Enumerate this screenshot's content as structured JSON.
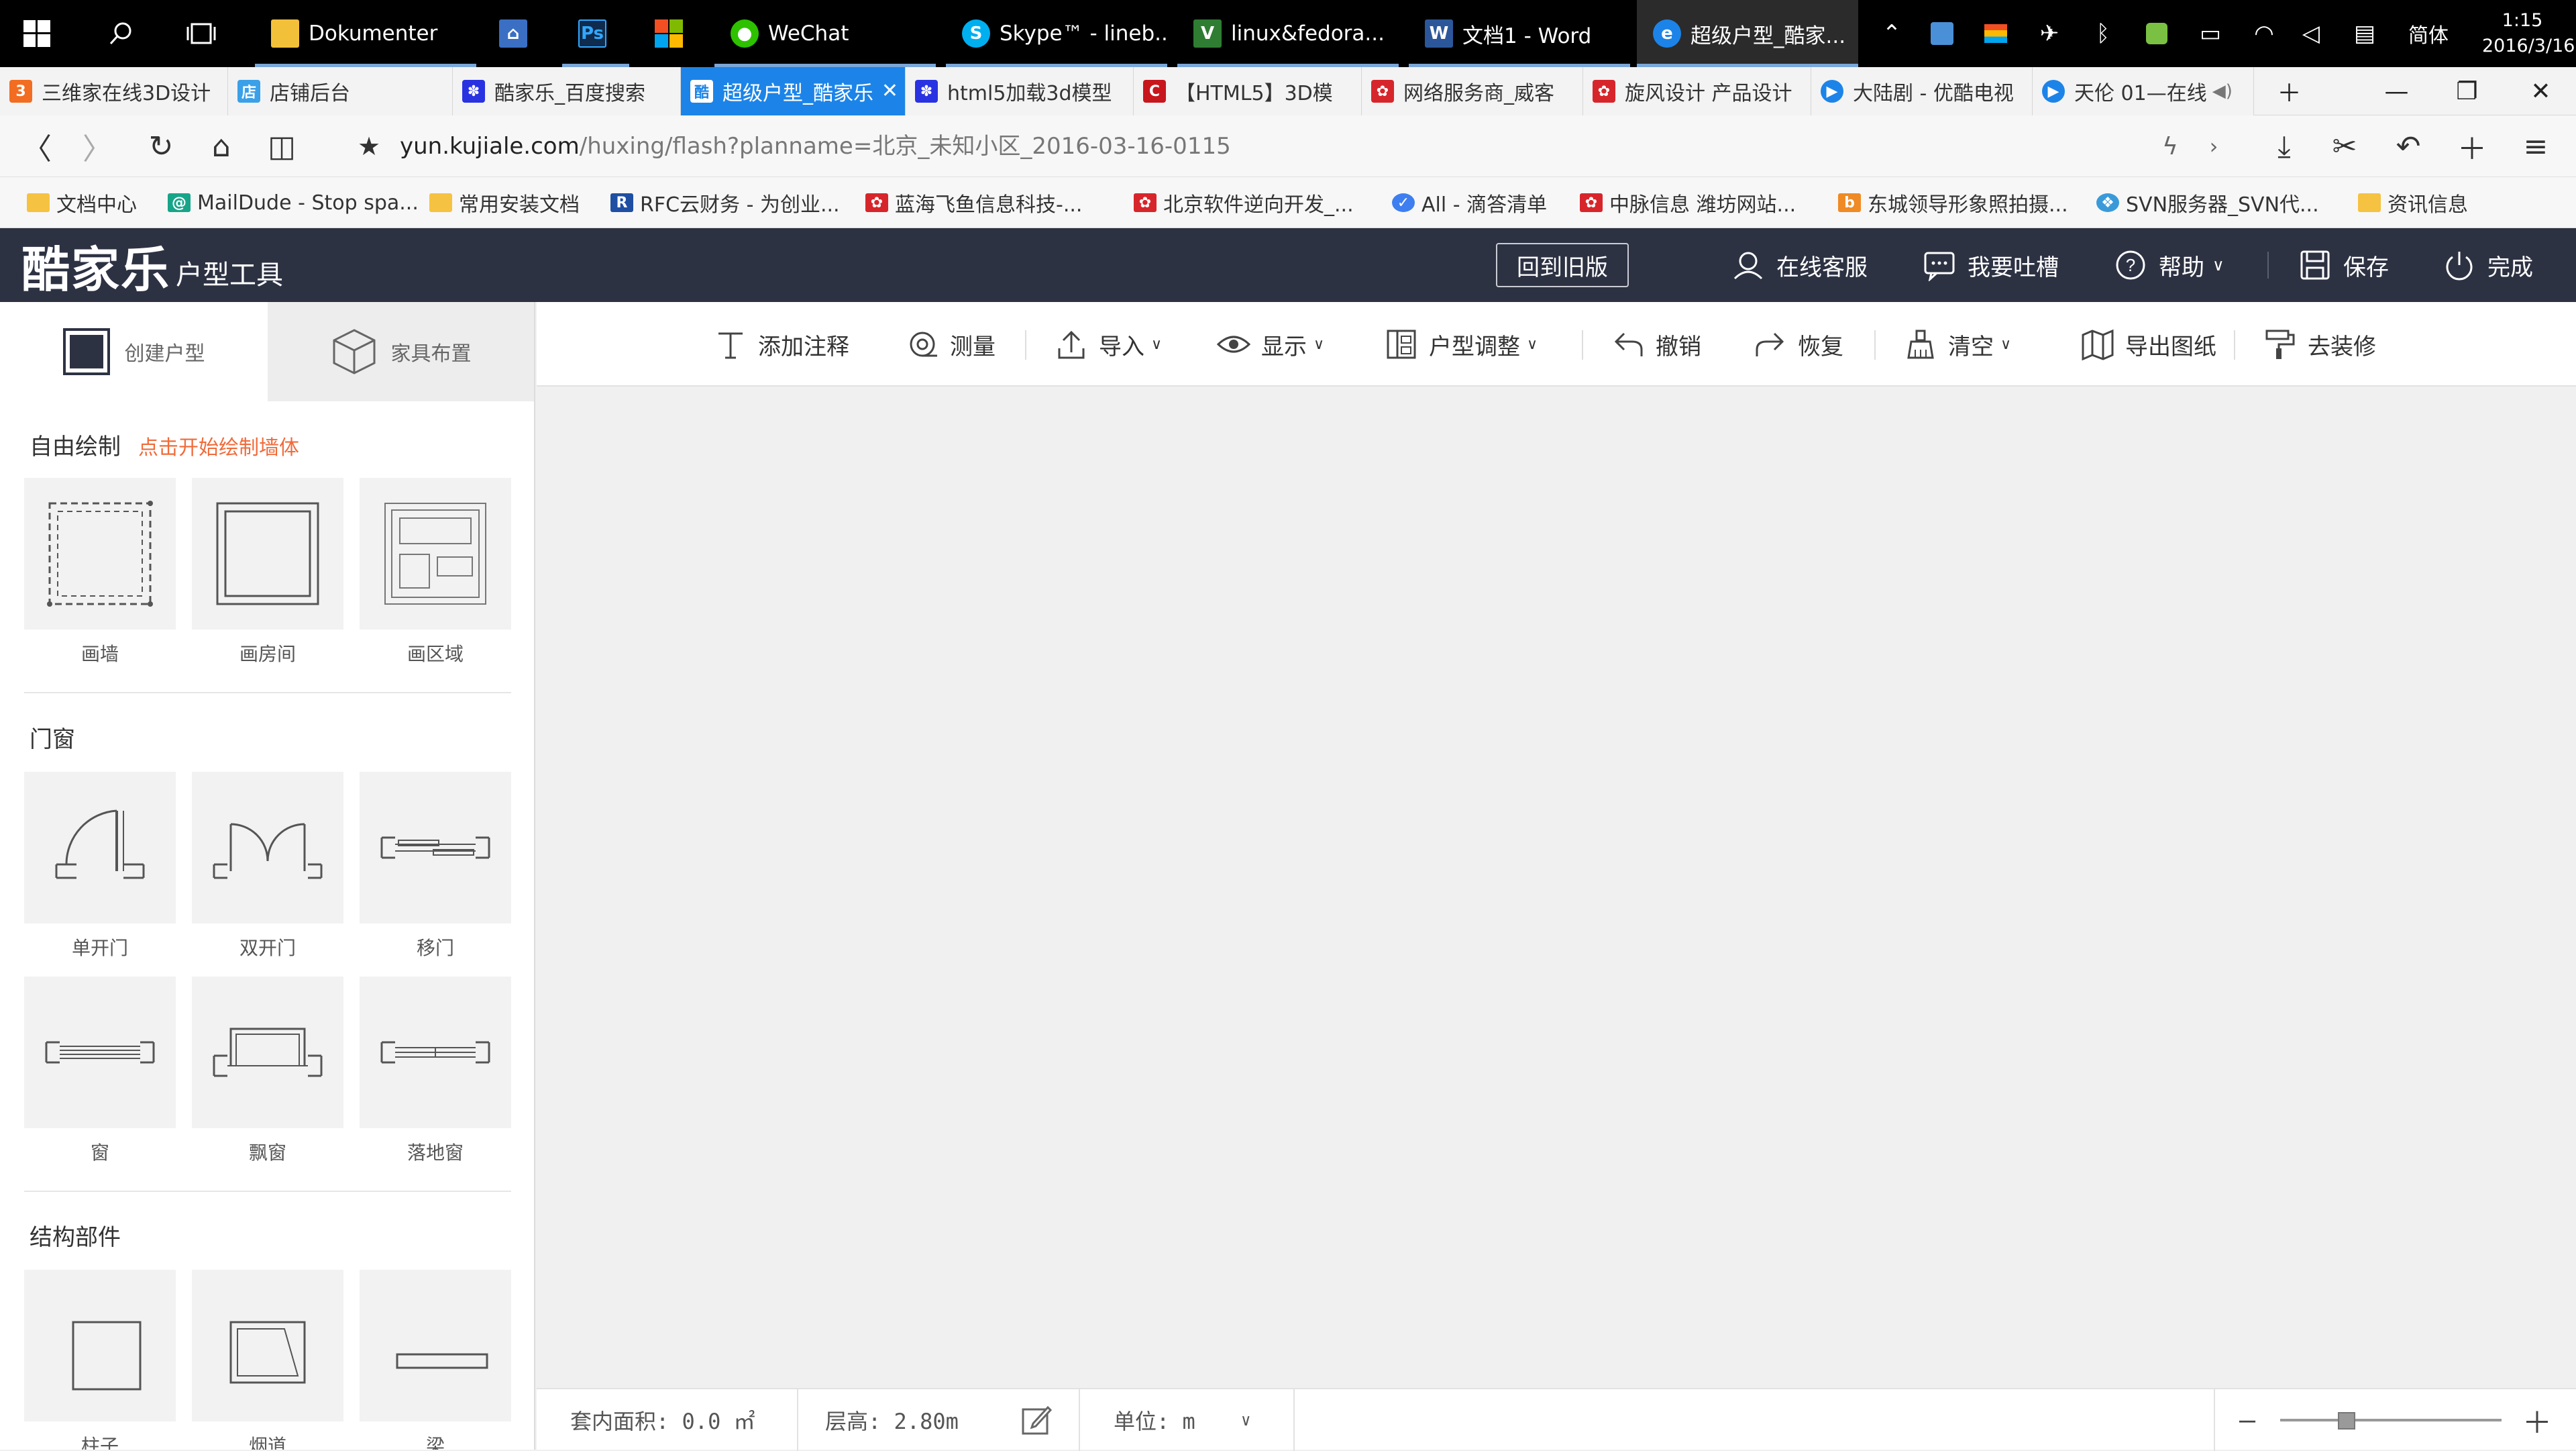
{
  "taskbar": {
    "apps": [
      {
        "label": "Dokumenter",
        "icon": "folder-icon"
      },
      {
        "label": "",
        "icon": "network-icon"
      },
      {
        "label": "",
        "icon": "photoshop-icon",
        "glyph": "Ps"
      },
      {
        "label": "",
        "icon": "windows-store-icon"
      },
      {
        "label": "WeChat",
        "icon": "wechat-icon"
      },
      {
        "label": "Skype™ - lineb...",
        "icon": "skype-icon"
      },
      {
        "label": "linux&fedora...",
        "icon": "vim-icon"
      },
      {
        "label": "文档1 - Word",
        "icon": "word-icon"
      },
      {
        "label": "超级户型_酷家...",
        "icon": "browser-icon"
      }
    ],
    "ime": "简体",
    "time": "1:15",
    "date": "2016/3/16"
  },
  "browser": {
    "tabs": [
      {
        "label": "三维家在线3D设计"
      },
      {
        "label": "店铺后台"
      },
      {
        "label": "酷家乐_百度搜索"
      },
      {
        "label": "超级户型_酷家乐"
      },
      {
        "label": "html5加载3d模型"
      },
      {
        "label": "【HTML5】3D模"
      },
      {
        "label": "网络服务商_威客"
      },
      {
        "label": "旋风设计 产品设计"
      },
      {
        "label": "大陆剧 - 优酷电视"
      },
      {
        "label": "天伦 01—在线"
      }
    ],
    "url_host": "yun.kujiale.com",
    "url_path": "/huxing/flash?planname=北京_未知小区_2016-03-16-0115",
    "bookmarks": [
      {
        "label": "文档中心"
      },
      {
        "label": "MailDude - Stop spa..."
      },
      {
        "label": "常用安装文档"
      },
      {
        "label": "RFC云财务 - 为创业..."
      },
      {
        "label": "蓝海飞鱼信息科技-..."
      },
      {
        "label": "北京软件逆向开发_..."
      },
      {
        "label": "All - 滴答清单"
      },
      {
        "label": "中脉信息 潍坊网站..."
      },
      {
        "label": "东城领导形象照拍摄..."
      },
      {
        "label": "SVN服务器_SVN代..."
      },
      {
        "label": "资讯信息"
      }
    ]
  },
  "header": {
    "logo_main": "酷家乐",
    "logo_sub": "户型工具",
    "old_version": "回到旧版",
    "service": "在线客服",
    "feedback": "我要吐槽",
    "help": "帮助",
    "save": "保存",
    "done": "完成"
  },
  "panel": {
    "tab_create": "创建户型",
    "tab_furniture": "家具布置",
    "free_draw": "自由绘制",
    "free_draw_hint": "点击开始绘制墙体",
    "draw_items": [
      "画墙",
      "画房间",
      "画区域"
    ],
    "doors_windows": "门窗",
    "door_items": [
      "单开门",
      "双开门",
      "移门"
    ],
    "window_items": [
      "窗",
      "飘窗",
      "落地窗"
    ],
    "structure": "结构部件",
    "structure_items": [
      "柱子",
      "烟道",
      "梁"
    ]
  },
  "toolbar": {
    "annotate": "添加注释",
    "measure": "测量",
    "import": "导入",
    "display": "显示",
    "adjust": "户型调整",
    "undo": "撤销",
    "redo": "恢复",
    "clear": "清空",
    "export": "导出图纸",
    "decorate": "去装修"
  },
  "status": {
    "area": "套内面积: 0.0 ㎡",
    "height": "层高: 2.80m",
    "unit": "单位: m",
    "zoom_level": 0.3
  },
  "colors": {
    "header_bg": "#2d3243",
    "accent_tab": "#1c84e8",
    "hint": "#f06b3a",
    "canvas": "#f0f0f0"
  }
}
